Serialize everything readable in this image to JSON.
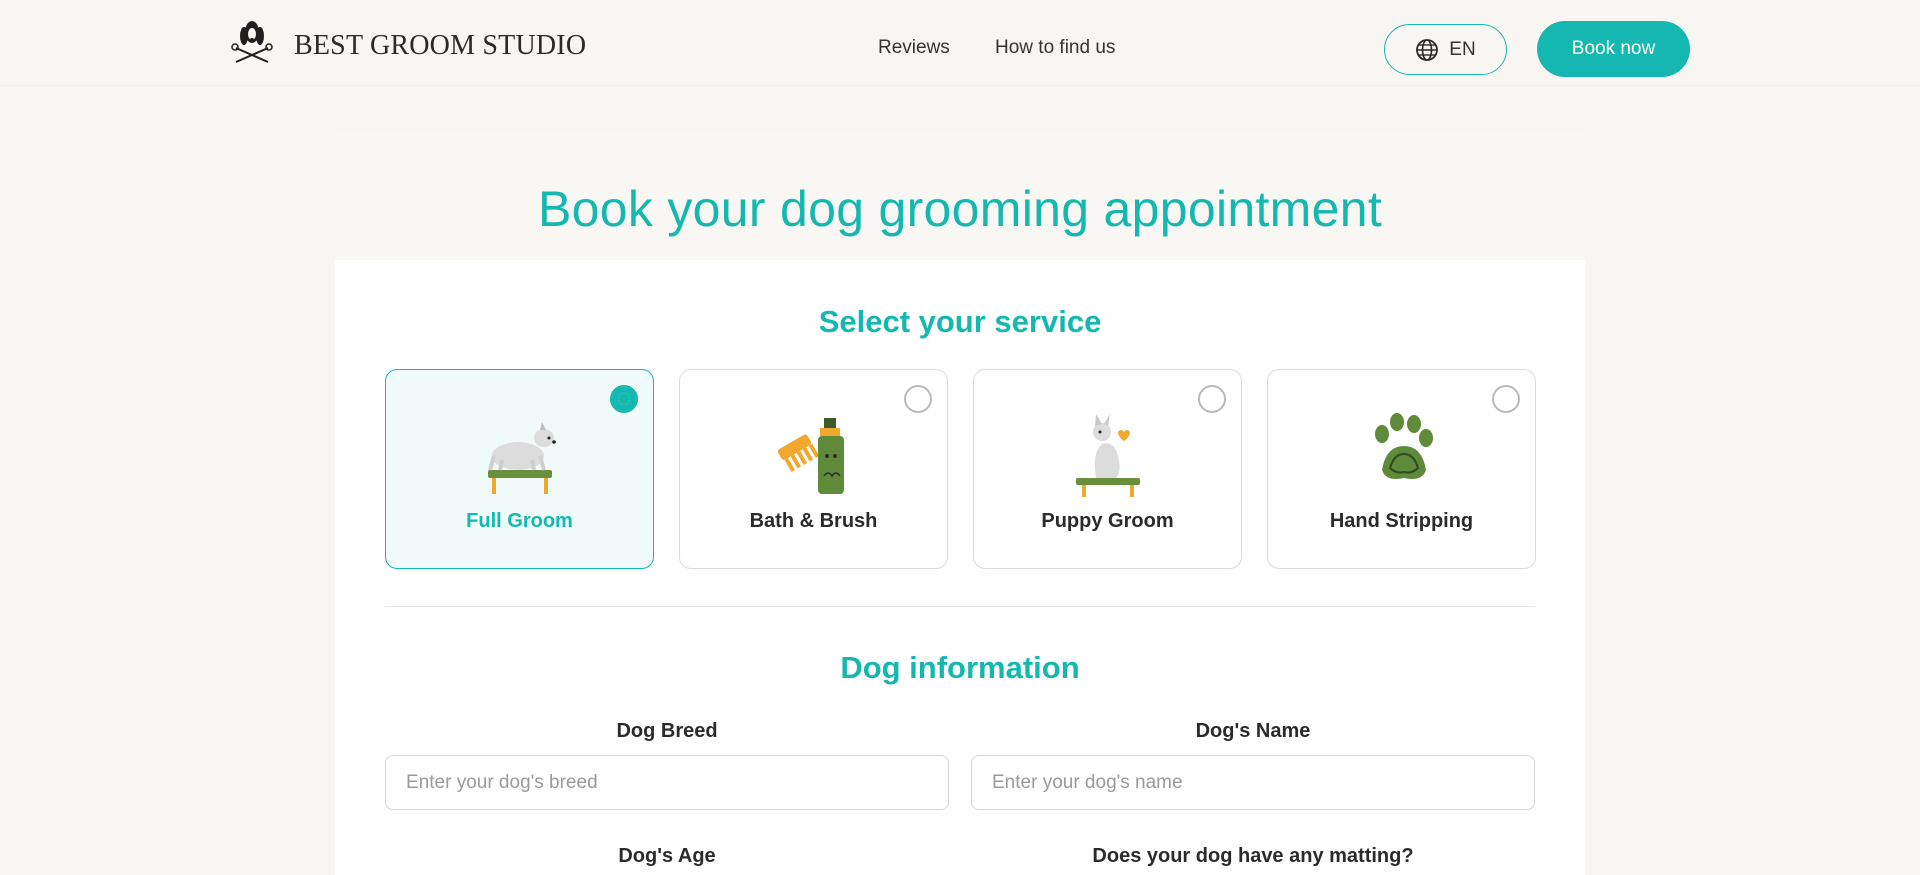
{
  "header": {
    "brand": "BEST GROOM STUDIO",
    "logo_text": "BEST GROOM STUDIO",
    "nav": [
      {
        "label": "Reviews"
      },
      {
        "label": "How to find us"
      }
    ],
    "language": {
      "label": "EN",
      "icon": "globe-icon"
    },
    "book_now": "Book now"
  },
  "main": {
    "title": "Book your dog grooming appointment",
    "service_section": {
      "title": "Select your service",
      "services": [
        {
          "label": "Full Groom",
          "selected": true,
          "icon": "dog-on-table-icon"
        },
        {
          "label": "Bath & Brush",
          "selected": false,
          "icon": "comb-and-shampoo-icon"
        },
        {
          "label": "Puppy Groom",
          "selected": false,
          "icon": "puppy-on-table-icon"
        },
        {
          "label": "Hand Stripping",
          "selected": false,
          "icon": "paw-icon"
        }
      ]
    },
    "dog_section": {
      "title": "Dog information",
      "fields": {
        "breed": {
          "label": "Dog Breed",
          "placeholder": "Enter your dog's breed",
          "value": ""
        },
        "name": {
          "label": "Dog's Name",
          "placeholder": "Enter your dog's name",
          "value": ""
        },
        "age": {
          "label": "Dog's Age"
        },
        "matting": {
          "label": "Does your dog have any matting?"
        }
      }
    }
  },
  "colors": {
    "accent": "#14b8b0",
    "background": "#f7f6f2",
    "card": "#ffffff",
    "selected_bg": "#f0faf9"
  }
}
